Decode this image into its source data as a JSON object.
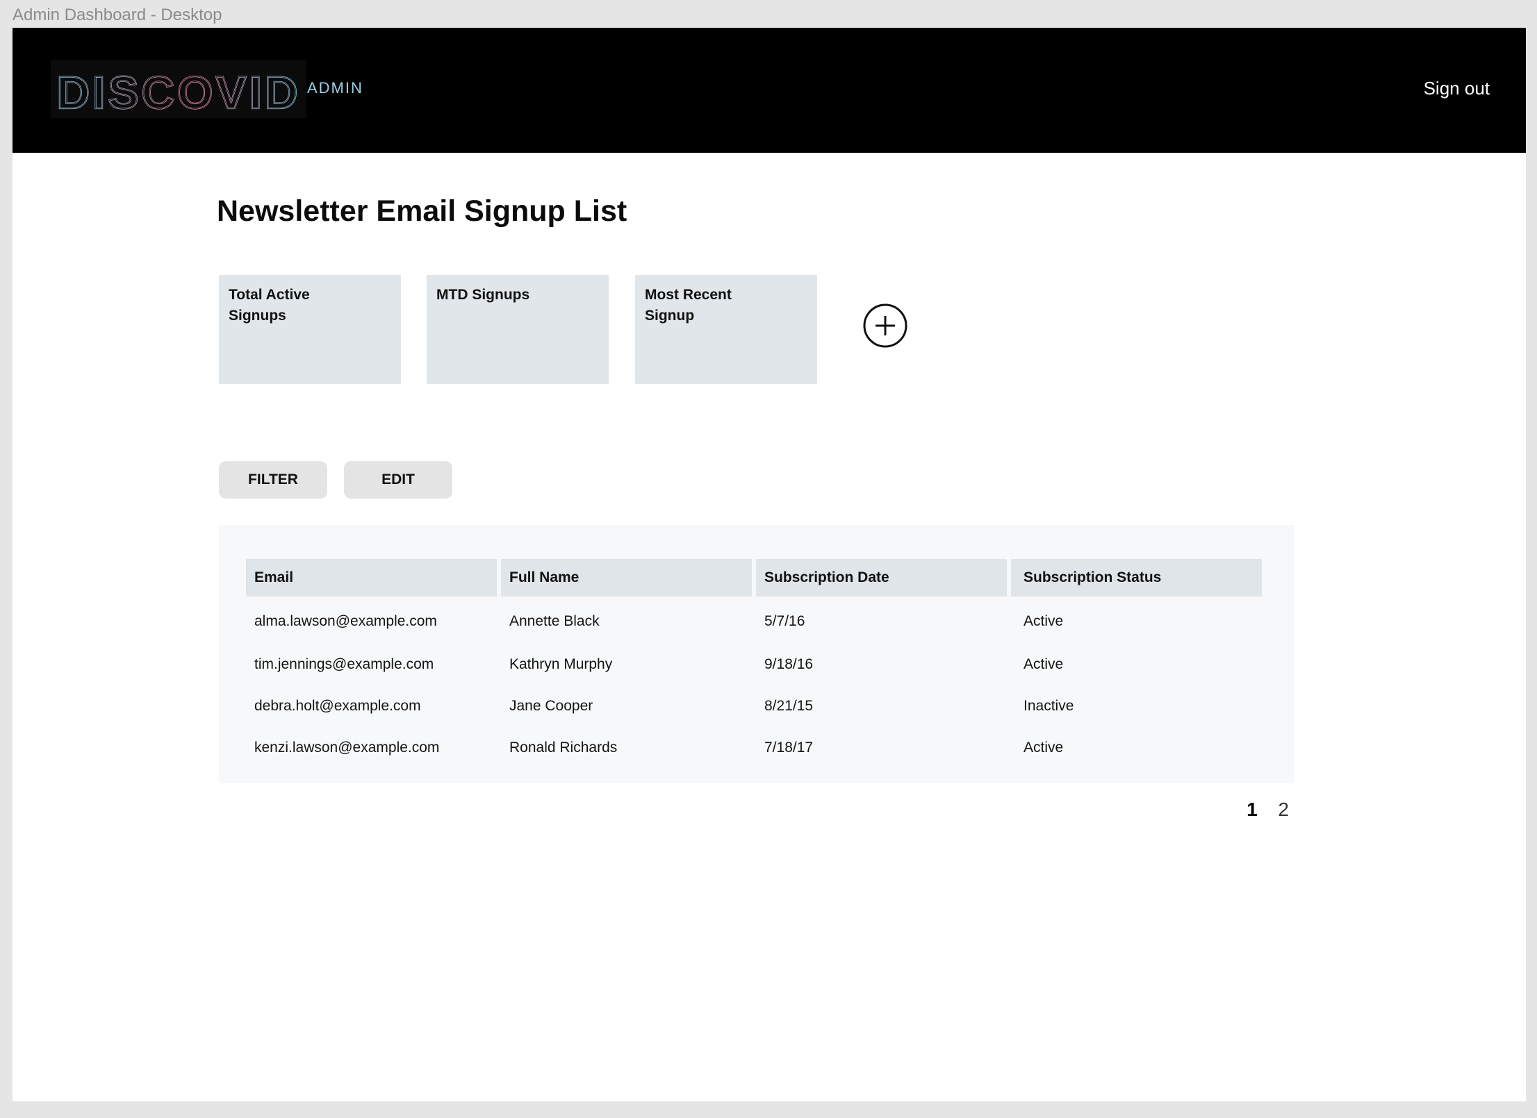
{
  "window": {
    "title": "Admin Dashboard - Desktop"
  },
  "header": {
    "logo_text": "DISCOVID",
    "admin_label": "ADMIN",
    "sign_out_label": "Sign out"
  },
  "main": {
    "title": "Newsletter Email Signup List",
    "stat_cards": [
      {
        "label": "Total Active Signups"
      },
      {
        "label": "MTD Signups"
      },
      {
        "label": "Most Recent Signup"
      }
    ],
    "add_card_icon": "plus-circle-icon",
    "actions": {
      "filter_label": "FILTER",
      "edit_label": "EDIT"
    },
    "table": {
      "columns": [
        "Email",
        "Full Name",
        "Subscription Date",
        "Subscription Status"
      ],
      "rows": [
        [
          "alma.lawson@example.com",
          "Annette Black",
          "5/7/16",
          "Active"
        ],
        [
          "tim.jennings@example.com",
          "Kathryn Murphy",
          "9/18/16",
          "Active"
        ],
        [
          "debra.holt@example.com",
          "Jane Cooper",
          "8/21/15",
          "Inactive"
        ],
        [
          "kenzi.lawson@example.com",
          "Ronald Richards",
          "7/18/17",
          "Active"
        ]
      ]
    },
    "pagination": {
      "pages": [
        "1",
        "2"
      ],
      "current": "1"
    }
  },
  "colors": {
    "header_bg": "#000000",
    "card_bg": "#e0e6e9",
    "table_panel_bg": "#f6f8f9",
    "button_bg": "#e4e4e4",
    "logo_cyan": "#8fd6ec",
    "logo_pink": "#e8809a"
  }
}
